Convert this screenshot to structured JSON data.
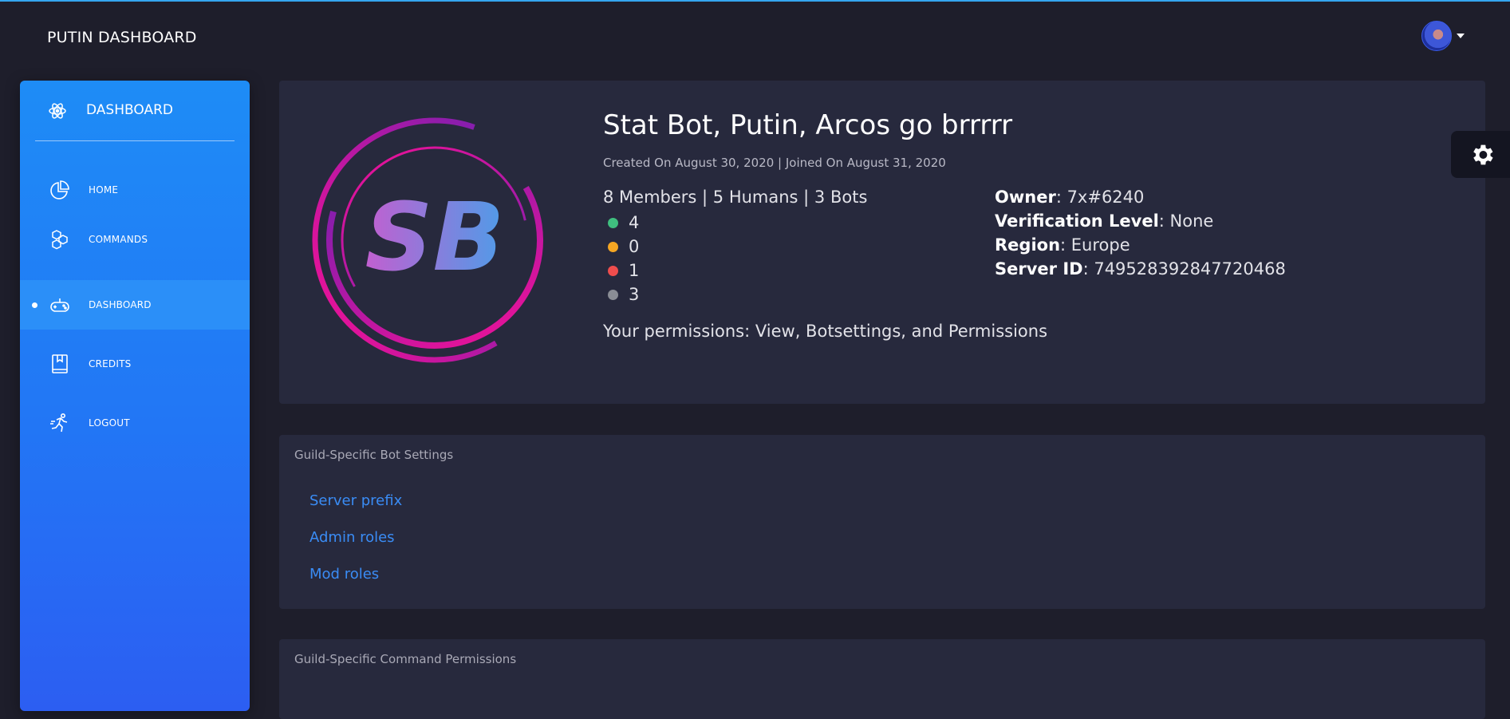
{
  "header": {
    "brand": "PUTIN DASHBOARD",
    "user_menu_icon": "avatar-with-caret"
  },
  "sidebar": {
    "title": "DASHBOARD",
    "title_icon": "atom-icon",
    "items": [
      {
        "label": "HOME",
        "icon": "pie-chart-icon",
        "active": false
      },
      {
        "label": "COMMANDS",
        "icon": "hexagons-icon",
        "active": false
      },
      {
        "label": "DASHBOARD",
        "icon": "gamepad-icon",
        "active": true
      },
      {
        "label": "CREDITS",
        "icon": "book-icon",
        "active": false
      },
      {
        "label": "LOGOUT",
        "icon": "running-person-icon",
        "active": false
      }
    ]
  },
  "guild": {
    "logo_text": "SB",
    "name": "Stat Bot, Putin, Arcos go brrrrr",
    "dates": "Created On August 30, 2020 | Joined On August 31, 2020",
    "members_summary": "8 Members | 5 Humans | 3 Bots",
    "statuses": [
      {
        "count": "4",
        "color": "#3fbf7f"
      },
      {
        "count": "0",
        "color": "#f5a623"
      },
      {
        "count": "1",
        "color": "#ef4d4d"
      },
      {
        "count": "3",
        "color": "#8a8d95"
      }
    ],
    "info": [
      {
        "key": "Owner",
        "value": ": 7x#6240"
      },
      {
        "key": "Verification Level",
        "value": ": None"
      },
      {
        "key": "Region",
        "value": ": Europe"
      },
      {
        "key": "Server ID",
        "value": ": 749528392847720468"
      }
    ],
    "permissions": "Your permissions: View, Botsettings, and Permissions"
  },
  "bot_settings": {
    "title": "Guild-Specific Bot Settings",
    "links": [
      "Server prefix",
      "Admin roles",
      "Mod roles"
    ]
  },
  "command_permissions": {
    "title": "Guild-Specific Command Permissions"
  },
  "floating": {
    "settings_icon": "gear-icon"
  },
  "colors": {
    "background": "#1e1e2b",
    "card": "#27293d",
    "sidebar_top": "#1e8cf6",
    "sidebar_bottom": "#2c5ef2",
    "link": "#3a8cf5",
    "accent_line": "#35a6f0"
  }
}
